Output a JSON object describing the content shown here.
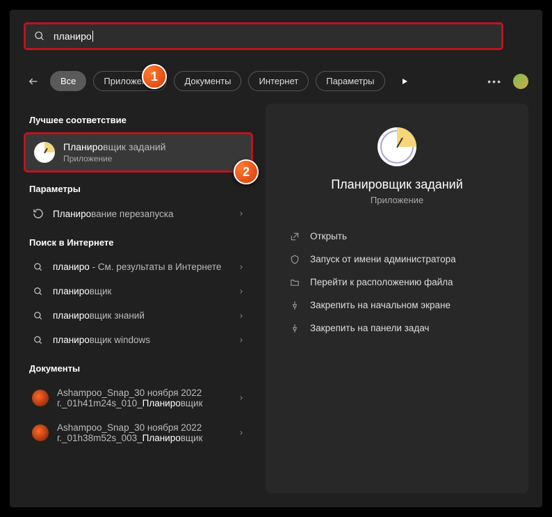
{
  "search": {
    "query": "планиро",
    "bold": "планиро"
  },
  "tabs": {
    "all": "Все",
    "apps": "Приложения",
    "docs": "Документы",
    "web": "Интернет",
    "settings": "Параметры"
  },
  "callouts": {
    "one": "1",
    "two": "2"
  },
  "sections": {
    "best": "Лучшее соответствие",
    "settings": "Параметры",
    "web": "Поиск в Интернете",
    "docs": "Документы"
  },
  "bestMatch": {
    "bold": "Планиро",
    "rest": "вщик заданий",
    "sub": "Приложение"
  },
  "settingsRows": [
    {
      "bold": "Планиро",
      "rest": "вание перезапуска"
    }
  ],
  "webRows": [
    {
      "bold": "планиро",
      "rest": "",
      "sub": " - См. результаты в Интернете"
    },
    {
      "bold": "планиро",
      "rest": "вщик",
      "sub": ""
    },
    {
      "bold": "планиро",
      "rest": "вщик знаний",
      "sub": ""
    },
    {
      "bold": "планиро",
      "rest": "вщик windows",
      "sub": ""
    }
  ],
  "docRows": [
    {
      "line1_a": "Ashampoo_Snap_30 ноября 2022",
      "line2_a": "г._01h41m24s_010_",
      "line2_bold": "Планиро",
      "line2_c": "вщик"
    },
    {
      "line1_a": "Ashampoo_Snap_30 ноября 2022",
      "line2_a": "г._01h38m52s_003_",
      "line2_bold": "Планиро",
      "line2_c": "вщик"
    }
  ],
  "preview": {
    "title": "Планировщик заданий",
    "sub": "Приложение"
  },
  "actions": {
    "open": "Открыть",
    "admin": "Запуск от имени администратора",
    "location": "Перейти к расположению файла",
    "pin_start": "Закрепить на начальном экране",
    "pin_task": "Закрепить на панели задач"
  }
}
